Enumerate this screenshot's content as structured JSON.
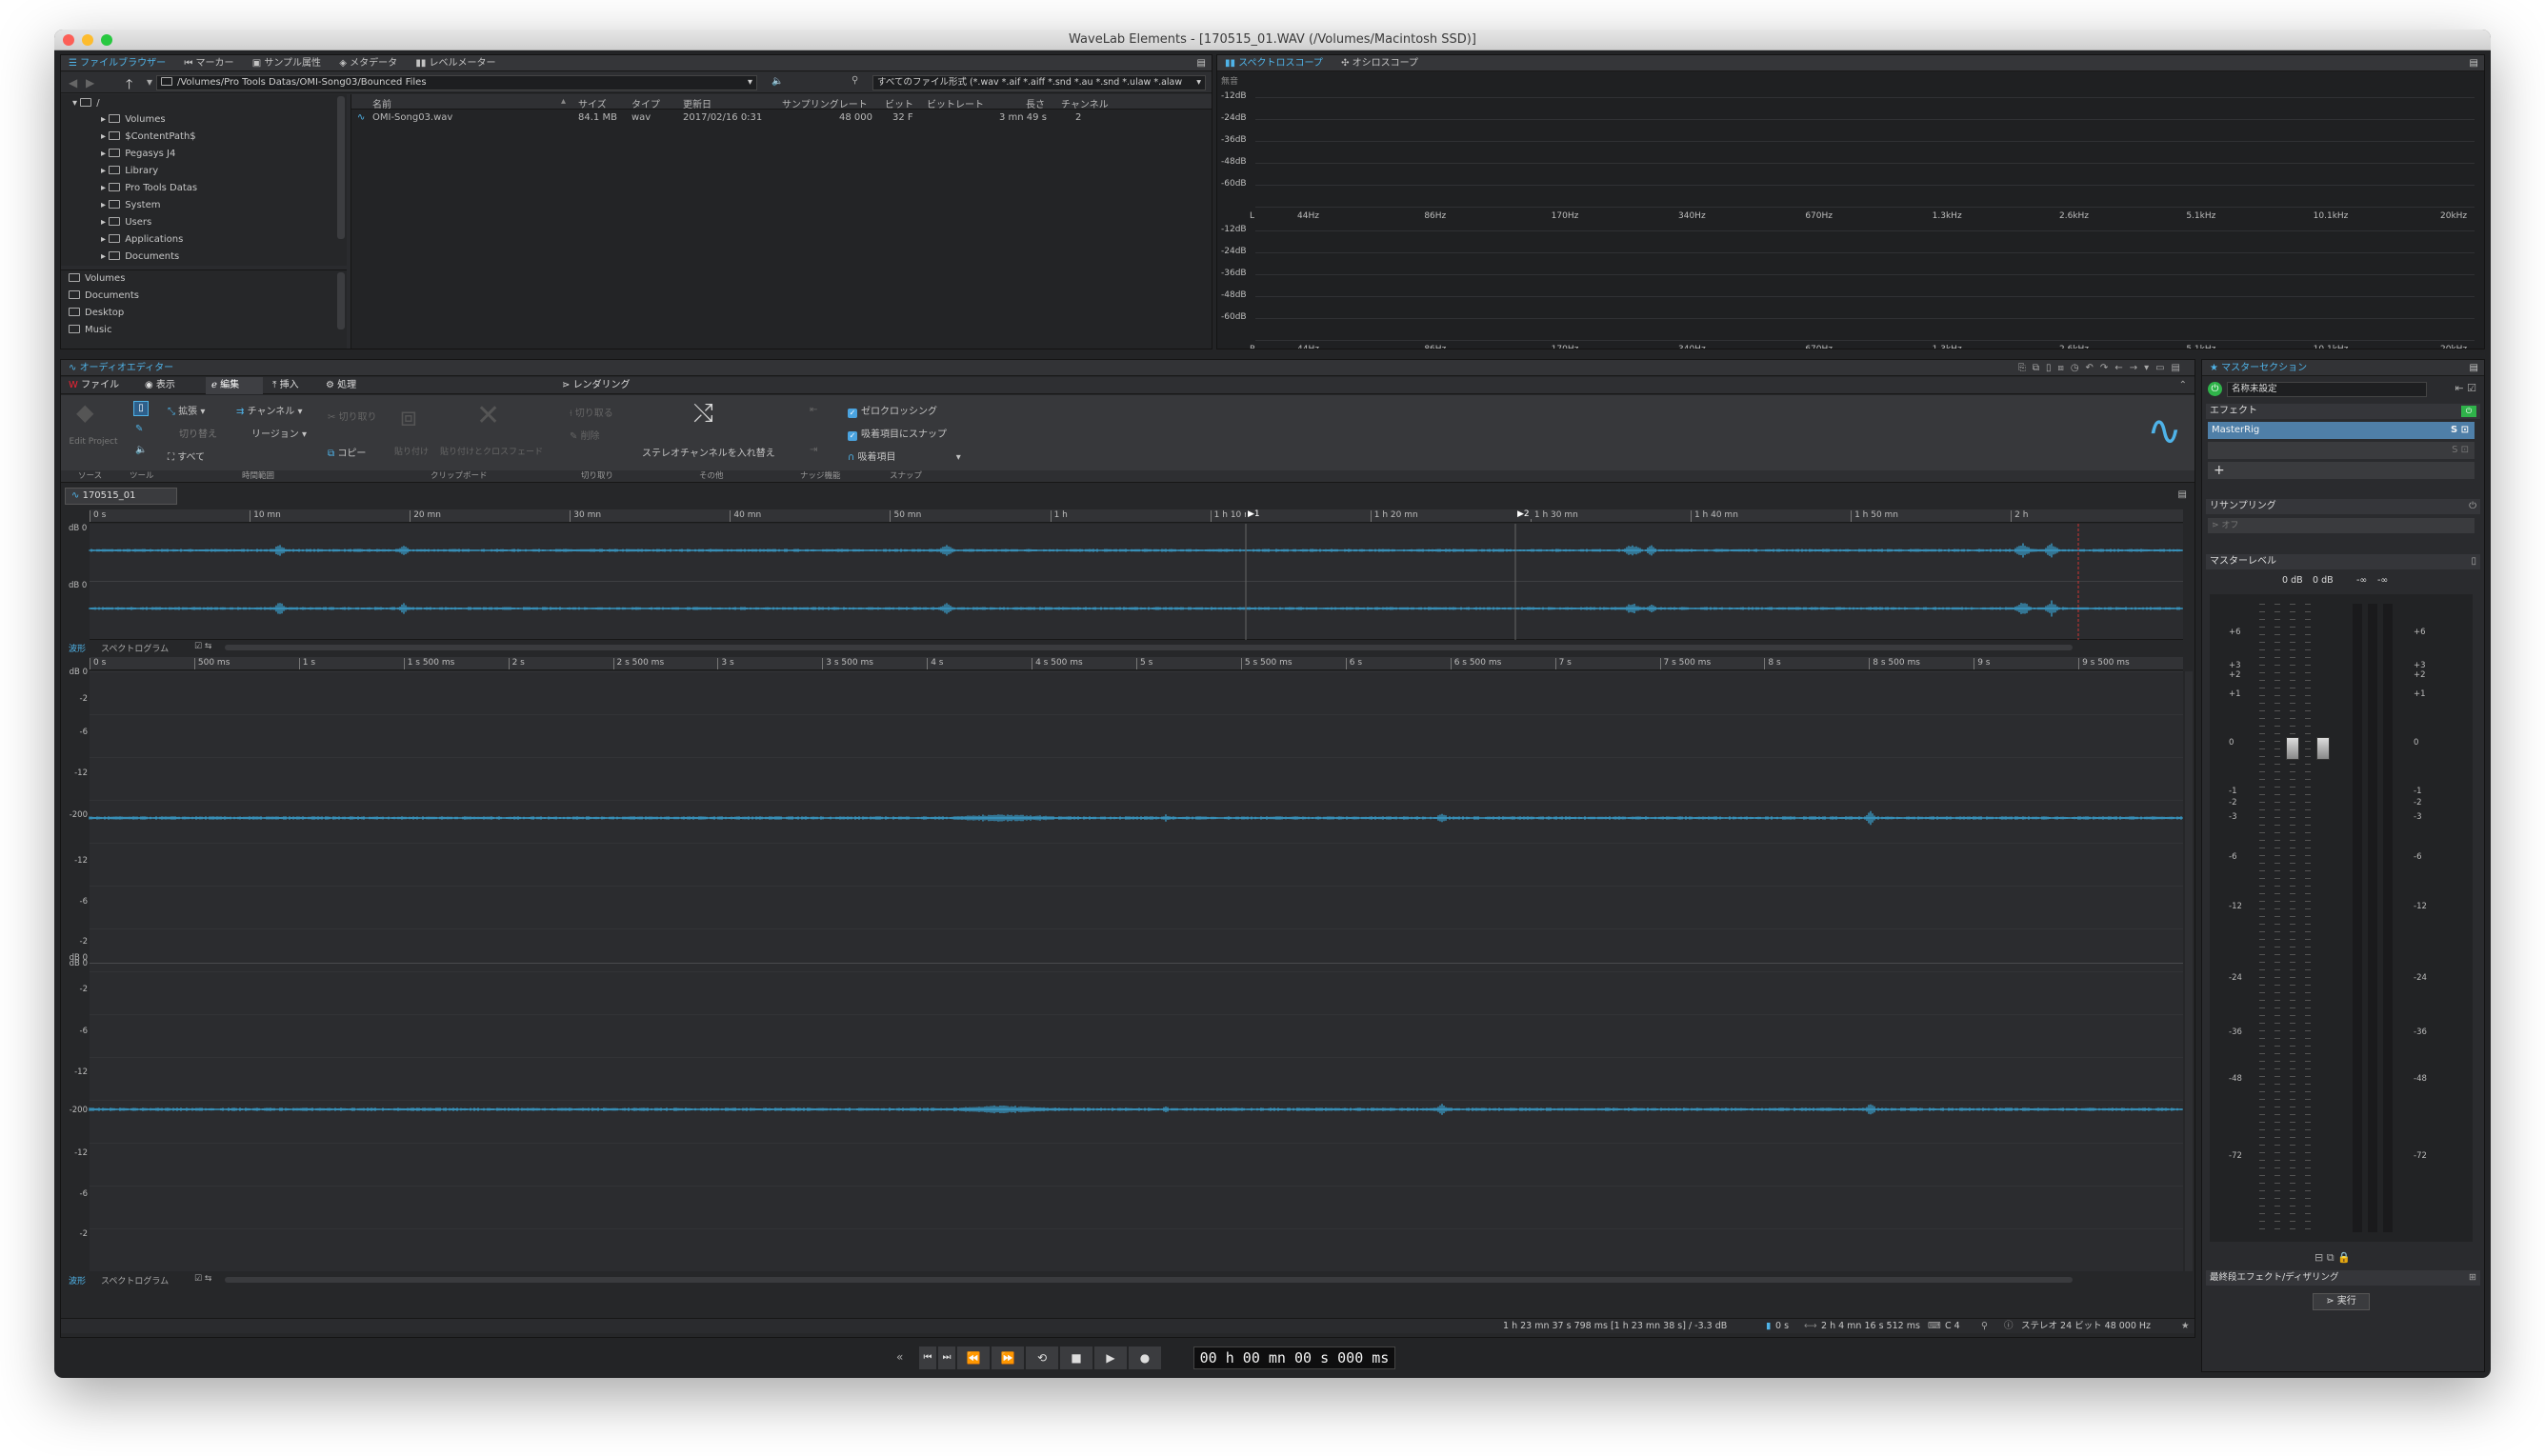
{
  "window": {
    "title": "WaveLab Elements - [170515_01.WAV (/Volumes/Macintosh SSD)]"
  },
  "browser": {
    "tabs": [
      "ファイルブラウザー",
      "マーカー",
      "サンプル属性",
      "メタデータ",
      "レベルメーター"
    ],
    "path": "/Volumes/Pro Tools Datas/OMI-Song03/Bounced Files",
    "filter": "すべてのファイル形式 (*.wav *.aif *.aiff *.snd *.au *.snd *.ulaw *.alaw",
    "tree_root": "/",
    "tree": [
      "Volumes",
      "$ContentPath$",
      "Pegasys J4",
      "Library",
      "Pro Tools Datas",
      "System",
      "Users",
      "Applications",
      "Documents"
    ],
    "favorites": [
      "Volumes",
      "Documents",
      "Desktop",
      "Music"
    ],
    "columns": [
      "名前",
      "サイズ",
      "タイプ",
      "更新日",
      "サンプリングレート",
      "ビット",
      "ビットレート",
      "長さ",
      "チャンネル"
    ],
    "rows": [
      {
        "name": "OMI-Song03.wav",
        "size": "84.1 MB",
        "type": "wav",
        "date": "2017/02/16 0:31",
        "rate": "48 000",
        "bits": "32 F",
        "bitrate": "",
        "length": "3 mn 49 s",
        "channels": "2"
      }
    ]
  },
  "analyzer": {
    "tabs": [
      "スペクトロスコープ",
      "オシロスコープ"
    ],
    "label": "無音",
    "db_top": [
      "-12dB",
      "-24dB",
      "-36dB",
      "-48dB",
      "-60dB"
    ],
    "db_bottom": [
      "-12dB",
      "-24dB",
      "-36dB",
      "-48dB",
      "-60dB"
    ],
    "ch_top": "L",
    "ch_bottom": "R",
    "freqs": [
      "44Hz",
      "86Hz",
      "170Hz",
      "340Hz",
      "670Hz",
      "1.3kHz",
      "2.6kHz",
      "5.1kHz",
      "10.1kHz",
      "20kHz"
    ]
  },
  "editor": {
    "title": "オーディオエディター",
    "menu_tabs": [
      "ファイル",
      "表示",
      "編集",
      "挿入",
      "処理",
      "レンダリング"
    ],
    "ribbon": {
      "edit_project": "Edit Project",
      "range": [
        "拡張",
        "切り替え",
        "すべて"
      ],
      "channel": "チャンネル",
      "region": "リージョン",
      "cut": "切り取り",
      "copy": "コピー",
      "paste": "貼り付け",
      "paste_cross": "貼り付けとクロスフェード",
      "trim": "切り取る",
      "delete": "削除",
      "swap": "ステレオチャンネルを入れ替え",
      "zero": "ゼロクロッシング",
      "snap_magnet": "吸着項目にスナップ",
      "magnet": "吸着項目",
      "groups": [
        "ソース",
        "ツール",
        "時間範囲",
        "クリップボード",
        "切り取り",
        "その他",
        "ナッジ機能",
        "スナップ"
      ]
    },
    "file_tab": "170515_01",
    "overview_ruler": [
      "0 s",
      "10 mn",
      "20 mn",
      "30 mn",
      "40 mn",
      "50 mn",
      "1 h",
      "1 h 10 mn",
      "1 h 20 mn",
      "1 h 30 mn",
      "1 h 40 mn",
      "1 h 50 mn",
      "2 h"
    ],
    "markers": [
      "1",
      "2"
    ],
    "main_ruler": [
      "0 s",
      "500 ms",
      "1 s",
      "1 s 500 ms",
      "2 s",
      "2 s 500 ms",
      "3 s",
      "3 s 500 ms",
      "4 s",
      "4 s 500 ms",
      "5 s",
      "5 s 500 ms",
      "6 s",
      "6 s 500 ms",
      "7 s",
      "7 s 500 ms",
      "8 s",
      "8 s 500 ms",
      "9 s",
      "9 s 500 ms"
    ],
    "db_labels_overview": [
      "dB 0",
      "dB 0"
    ],
    "db_labels_main": [
      "dB 0",
      "-2",
      "-6",
      "-12",
      "-200",
      "-12",
      "-6",
      "-2",
      "dB 0",
      "dB 0",
      "-2",
      "-6",
      "-12",
      "-200",
      "-12",
      "-6",
      "-2"
    ],
    "view_mode": "波形",
    "spectrogram": "スペクトログラム",
    "status": {
      "cursor": "1 h 23 mn 37 s 798 ms [1 h 23 mn 38 s] / -3.3 dB",
      "selection": "0 s",
      "length": "2 h 4 mn 16 s 512 ms",
      "key": "C 4",
      "format": "ステレオ 24 ビット 48 000 Hz"
    },
    "transport_time": "00 h 00 mn 00 s 000 ms"
  },
  "master": {
    "title": "マスターセクション",
    "preset": "名称未設定",
    "effects": "エフェクト",
    "slot1": "MasterRig",
    "resampling": "リサンプリング",
    "resampling_value": "オフ",
    "master_level": "マスターレベル",
    "levels": [
      "0 dB",
      "0 dB",
      "-∞",
      "-∞"
    ],
    "scale": [
      "+6",
      "+3",
      "+2",
      "+1",
      "0",
      "-1",
      "-2",
      "-3",
      "-6",
      "-12",
      "-24",
      "-36",
      "-48",
      "-72"
    ],
    "final": "最終段エフェクト/ディザリング",
    "render": "実行"
  },
  "colors": {
    "accent": "#4fb3e8",
    "wave": "#3aa7d8",
    "green": "#2fb34a"
  }
}
